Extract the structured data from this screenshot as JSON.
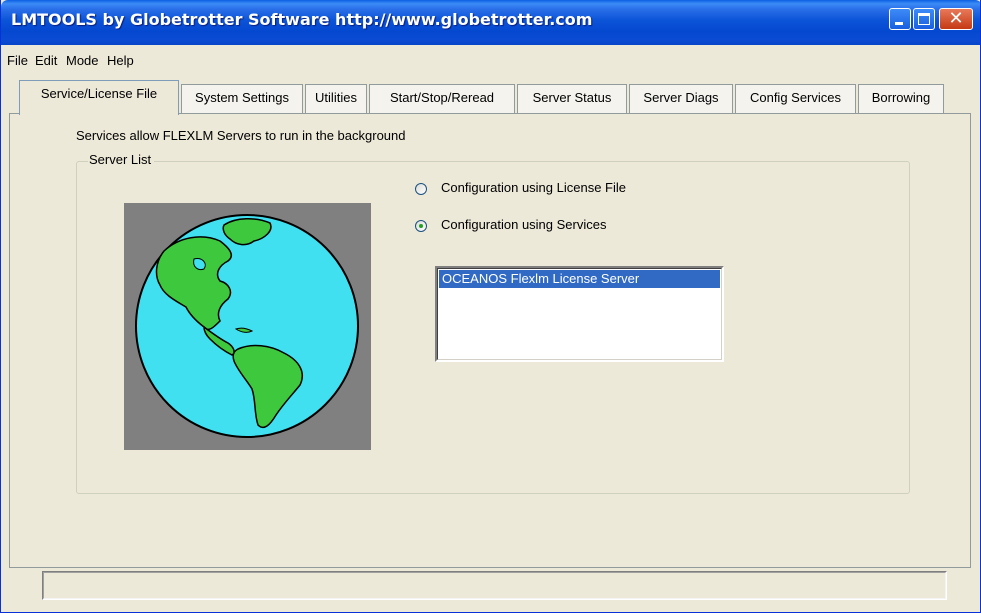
{
  "window": {
    "title": "LMTOOLS by Globetrotter Software http://www.globetrotter.com",
    "accent_color": "#0b54d8"
  },
  "menubar": {
    "items": [
      "File",
      "Edit",
      "Mode",
      "Help"
    ]
  },
  "tabs": [
    {
      "label": "Service/License File",
      "active": true
    },
    {
      "label": "System Settings",
      "active": false
    },
    {
      "label": "Utilities",
      "active": false
    },
    {
      "label": "Start/Stop/Reread",
      "active": false
    },
    {
      "label": "Server Status",
      "active": false
    },
    {
      "label": "Server Diags",
      "active": false
    },
    {
      "label": "Config Services",
      "active": false
    },
    {
      "label": "Borrowing",
      "active": false
    }
  ],
  "panel": {
    "description": "Services allow FLEXLM Servers to run in the background",
    "group_label": "Server List",
    "image": "globe-icon",
    "radios": [
      {
        "label": "Configuration using License File",
        "checked": false
      },
      {
        "label": "Configuration using Services",
        "checked": true
      }
    ],
    "services_list": [
      {
        "label": "OCEANOS Flexlm License Server",
        "selected": true
      }
    ]
  },
  "statusbar": {
    "text": ""
  }
}
